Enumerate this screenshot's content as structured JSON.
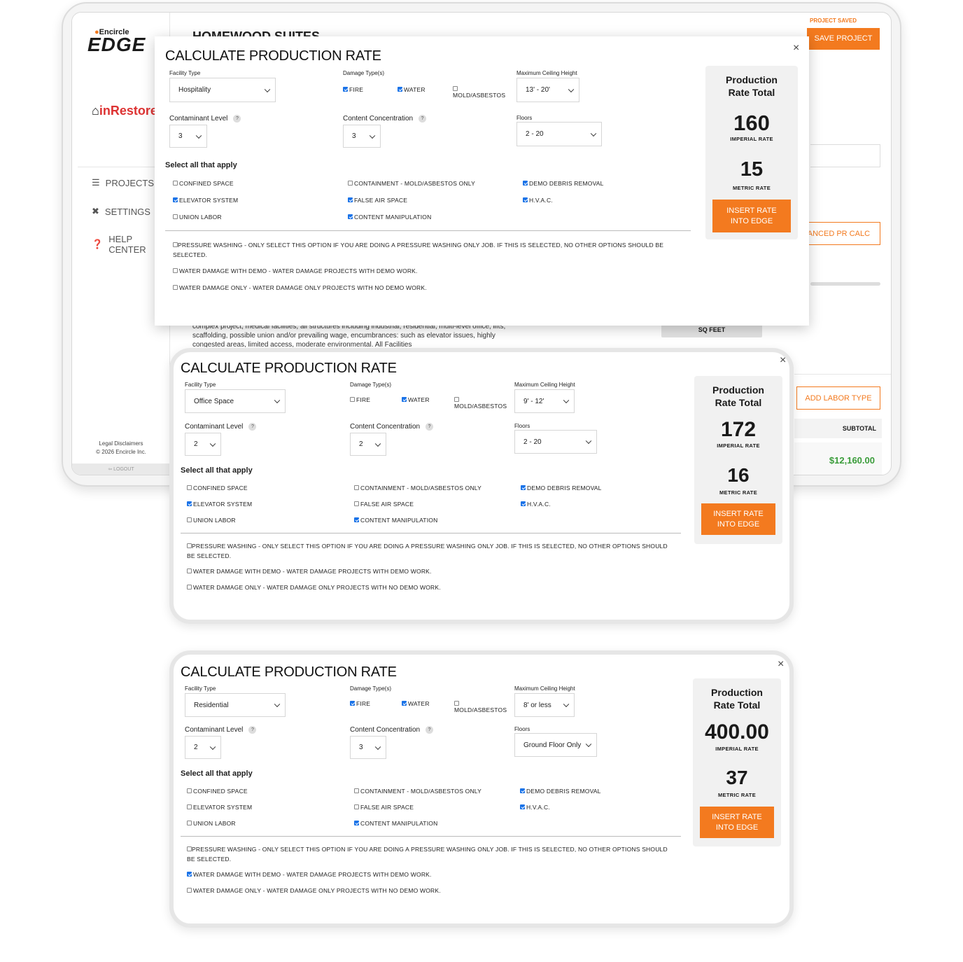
{
  "background": {
    "brand_top": "Encircle",
    "brand_main": "EDGE",
    "partner_logo": "inRestore",
    "project_title": "HOMEWOOD SUITES",
    "nav": [
      {
        "label": "PROJECTS",
        "icon": "list-icon"
      },
      {
        "label": "SETTINGS",
        "icon": "tools-icon"
      },
      {
        "label": "HELP CENTER",
        "icon": "help-icon"
      }
    ],
    "legal": "Legal Disclaimers",
    "copyright": "© 2026 Encircle Inc.",
    "logout": "LOGOUT",
    "project_saved": "PROJECT SAVED",
    "save_project": "SAVE PROJECT",
    "advanced_pr_calc": "ADVANCED PR CALC",
    "add_labor_type": "ADD LABOR TYPE",
    "subtotal_label": "SUBTOTAL",
    "subtotal_value": "$12,160.00",
    "sq_feet": "SQ FEET",
    "description": "complex project, medical facilities, all structures including industrial, residential, multi-level office, lifts, scaffolding, possible union and/or prevailing wage, encumbrances: such as elevator issues, highly congested areas, limited access, moderate environmental. All Facilities"
  },
  "labels": {
    "title": "CALCULATE PRODUCTION RATE",
    "close": "×",
    "facility_type": "Facility Type",
    "damage_types": "Damage Type(s)",
    "max_ceiling": "Maximum Ceiling Height",
    "contaminant_level": "Contaminant Level",
    "content_concentration": "Content Concentration",
    "floors": "Floors",
    "help": "?",
    "select_all": "Select all that apply",
    "fire": "FIRE",
    "water": "WATER",
    "mold": "MOLD/ASBESTOS",
    "confined_space": "CONFINED SPACE",
    "containment": "CONTAINMENT - MOLD/ASBESTOS ONLY",
    "demo_debris": "DEMO DEBRIS REMOVAL",
    "elevator": "ELEVATOR SYSTEM",
    "false_air": "FALSE AIR SPACE",
    "hvac": "H.V.A.C.",
    "union_labor": "UNION LABOR",
    "content_manipulation": "CONTENT MANIPULATION",
    "pressure_washing": "PRESSURE WASHING - ONLY SELECT THIS OPTION IF YOU ARE DOING A PRESSURE WASHING ONLY JOB. IF THIS IS SELECTED, NO OTHER OPTIONS SHOULD BE SELECTED.",
    "water_demo": "WATER DAMAGE WITH DEMO - WATER DAMAGE PROJECTS WITH DEMO WORK.",
    "water_only": "WATER DAMAGE ONLY - WATER DAMAGE ONLY PROJECTS WITH NO DEMO WORK.",
    "pr_total_1": "Production",
    "pr_total_2": "Rate Total",
    "imperial_rate": "IMPERIAL RATE",
    "metric_rate": "METRIC RATE",
    "insert_1": "INSERT RATE",
    "insert_2": "INTO EDGE"
  },
  "modals": [
    {
      "facility": "Hospitality",
      "ceiling": "13' - 20'",
      "contaminant": "3",
      "concentration": "3",
      "floors": "2 - 20",
      "imperial": "160",
      "metric": "15",
      "checks": {
        "fire": true,
        "water": true,
        "mold": false,
        "confined": false,
        "containment": false,
        "demo": true,
        "elevator": true,
        "false_air": true,
        "hvac": true,
        "union": false,
        "content": true,
        "pressure": false,
        "water_demo": false,
        "water_only": false
      }
    },
    {
      "facility": "Office Space",
      "ceiling": "9' - 12'",
      "contaminant": "2",
      "concentration": "2",
      "floors": "2 - 20",
      "imperial": "172",
      "metric": "16",
      "checks": {
        "fire": false,
        "water": true,
        "mold": false,
        "confined": false,
        "containment": false,
        "demo": true,
        "elevator": true,
        "false_air": false,
        "hvac": true,
        "union": false,
        "content": true,
        "pressure": false,
        "water_demo": false,
        "water_only": false
      }
    },
    {
      "facility": "Residential",
      "ceiling": "8' or less",
      "contaminant": "2",
      "concentration": "3",
      "floors": "Ground Floor Only",
      "imperial": "400.00",
      "metric": "37",
      "checks": {
        "fire": true,
        "water": true,
        "mold": false,
        "confined": false,
        "containment": false,
        "demo": true,
        "elevator": false,
        "false_air": false,
        "hvac": true,
        "union": false,
        "content": true,
        "pressure": false,
        "water_demo": true,
        "water_only": false
      }
    }
  ]
}
